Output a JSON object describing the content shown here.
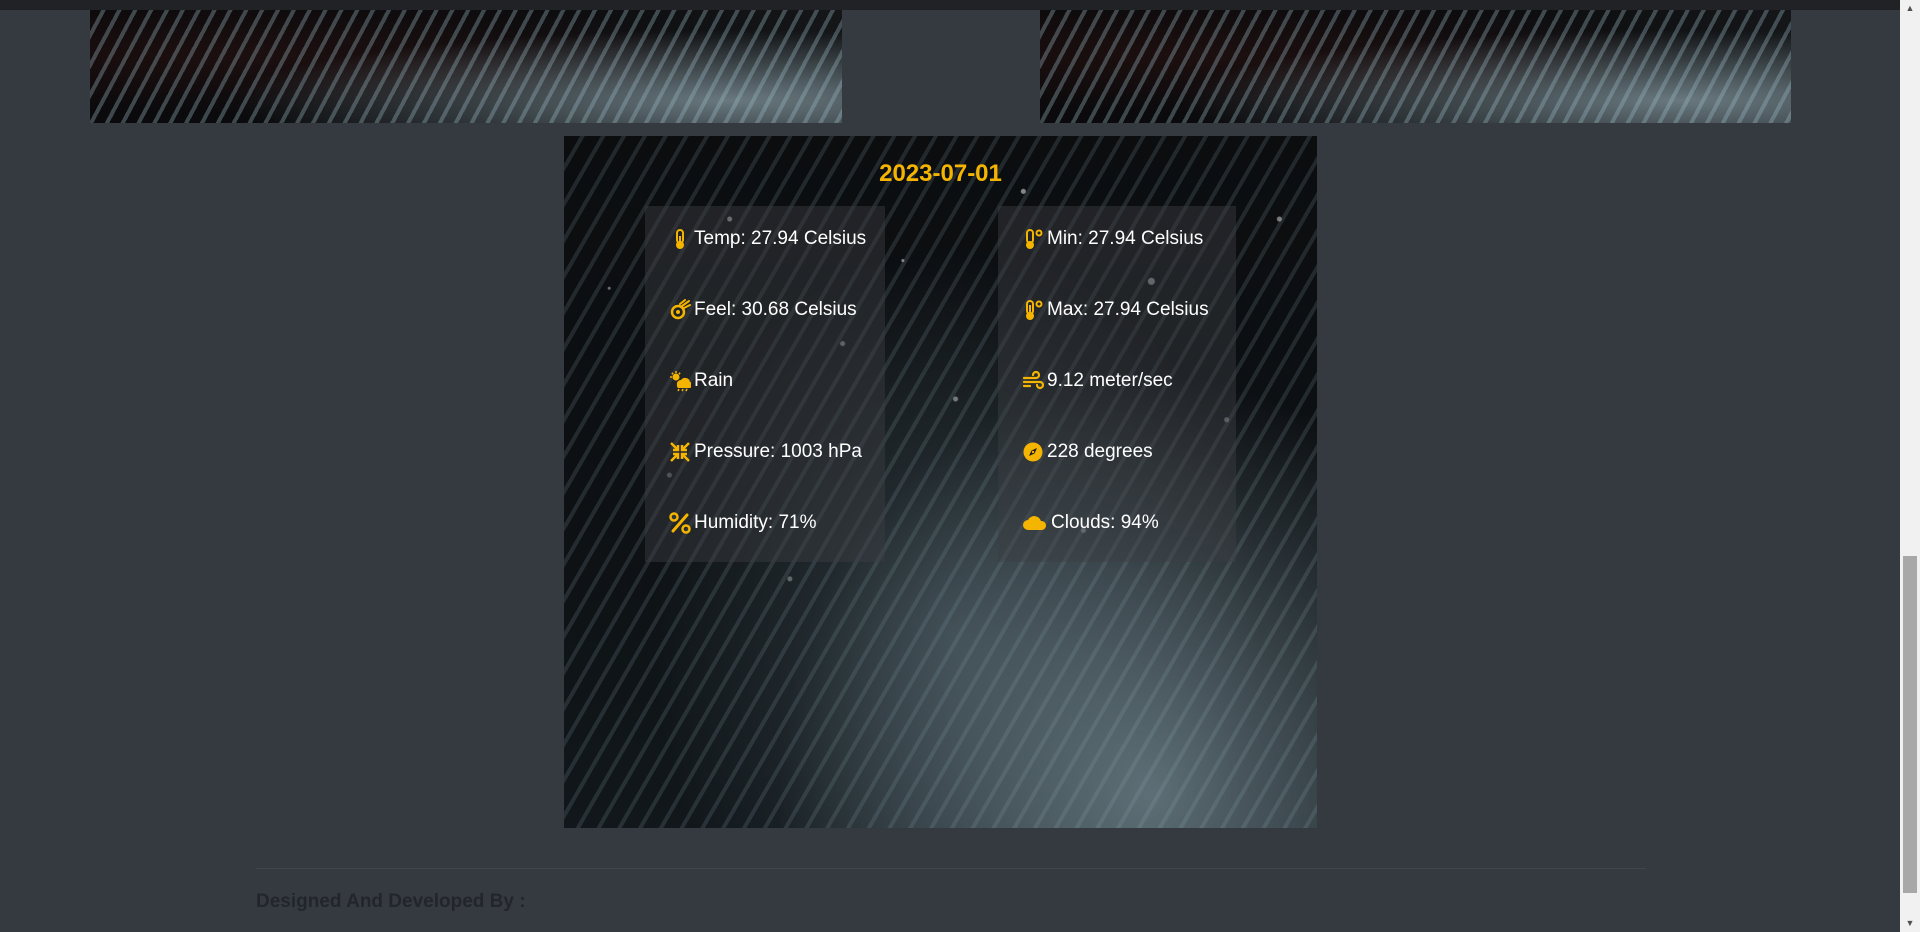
{
  "forecast": {
    "date": "2023-07-01",
    "left_items": [
      {
        "icon": "thermometer-half-icon",
        "text": "Temp: 27.94 Celsius"
      },
      {
        "icon": "meteor-icon",
        "text": "Feel: 30.68 Celsius"
      },
      {
        "icon": "cloud-sun-rain-icon",
        "text": "Rain"
      },
      {
        "icon": "compress-arrows-icon",
        "text": "Pressure: 1003 hPa"
      },
      {
        "icon": "percent-icon",
        "text": "Humidity: 71%"
      }
    ],
    "right_items": [
      {
        "icon": "temperature-low-icon",
        "text": "Min: 27.94 Celsius"
      },
      {
        "icon": "temperature-high-icon",
        "text": "Max: 27.94 Celsius"
      },
      {
        "icon": "wind-icon",
        "text": "9.12 meter/sec"
      },
      {
        "icon": "compass-icon",
        "text": "228 degrees"
      },
      {
        "icon": "cloud-icon",
        "text": "Clouds: 94%"
      }
    ]
  },
  "footer": {
    "credit_label": "Designed And Developed By :"
  },
  "colors": {
    "accent": "#f4b400",
    "page_background": "#343a40",
    "text": "#ffffff"
  }
}
